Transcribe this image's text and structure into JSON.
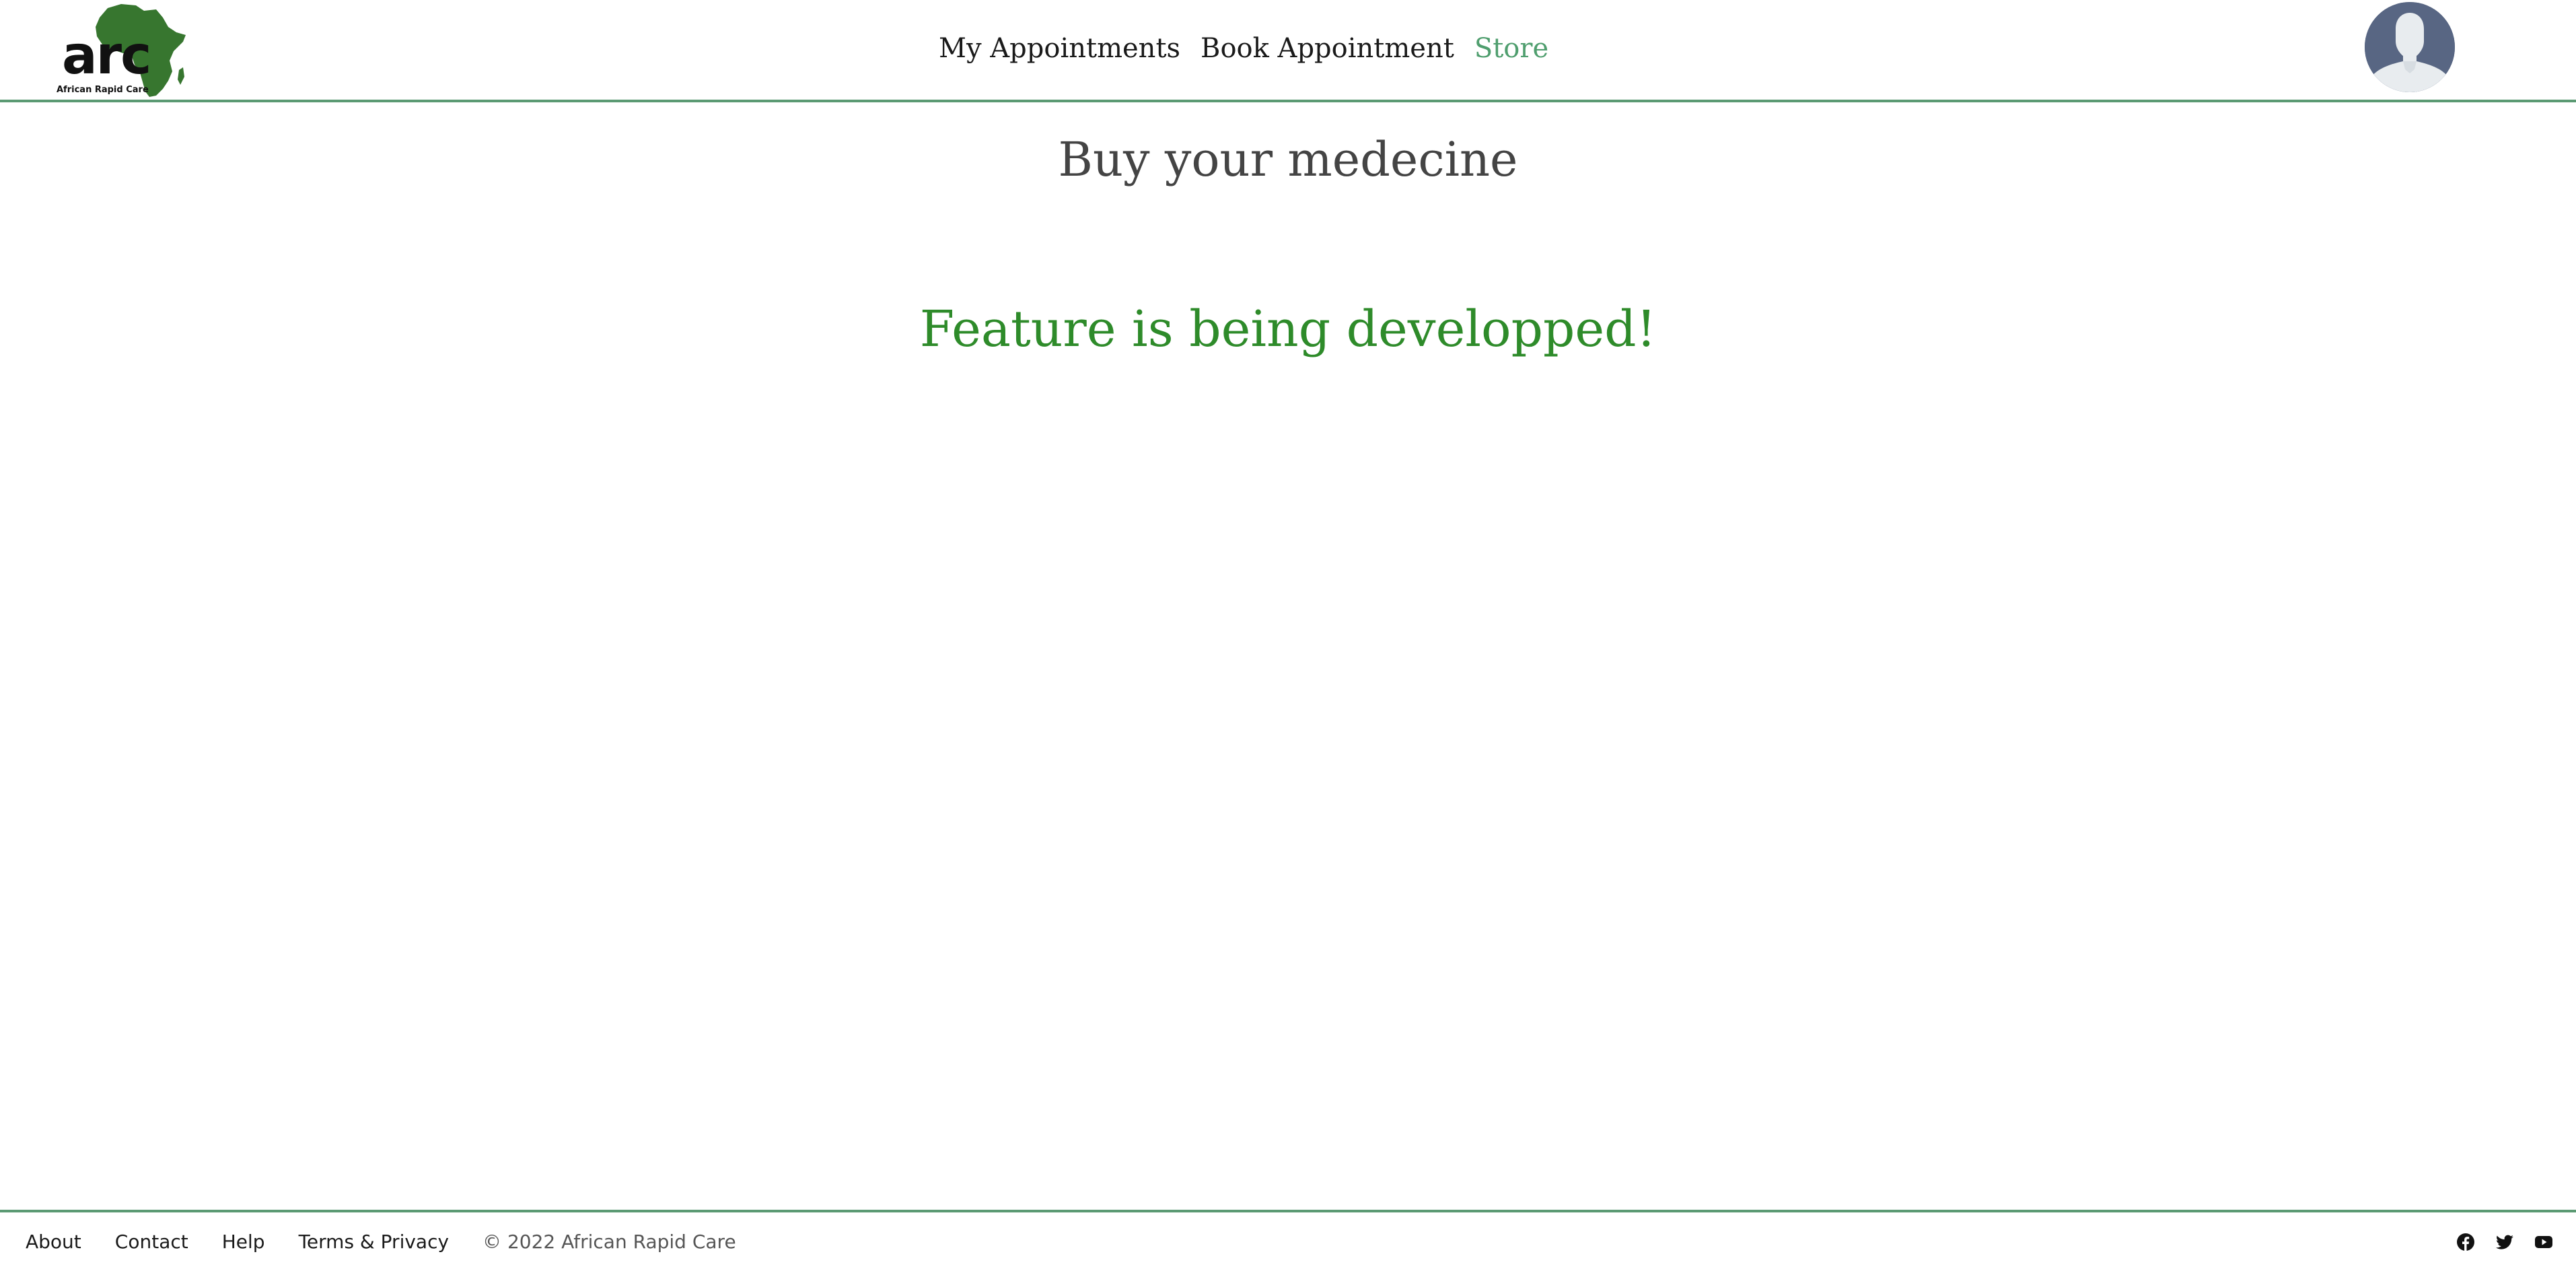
{
  "brand": {
    "logo_text": "arc",
    "logo_subtitle": "African Rapid Care",
    "logo_icon": "africa-map-icon",
    "logo_color": "#37762f"
  },
  "nav": {
    "items": [
      {
        "label": "My Appointments",
        "active": false
      },
      {
        "label": "Book Appointment",
        "active": false
      },
      {
        "label": "Store",
        "active": true
      }
    ],
    "active_color": "#4f9e6e"
  },
  "user": {
    "avatar_icon": "user-avatar-icon"
  },
  "main": {
    "title": "Buy your medecine",
    "message": "Feature is being developped!",
    "message_color": "#2e8b2a"
  },
  "footer": {
    "links": [
      "About",
      "Contact",
      "Help",
      "Terms & Privacy"
    ],
    "copyright": "© 2022 African Rapid Care",
    "socials": [
      "facebook-icon",
      "twitter-icon",
      "youtube-icon"
    ]
  },
  "colors": {
    "divider": "#5b9a73",
    "avatar_bg": "#586683"
  }
}
